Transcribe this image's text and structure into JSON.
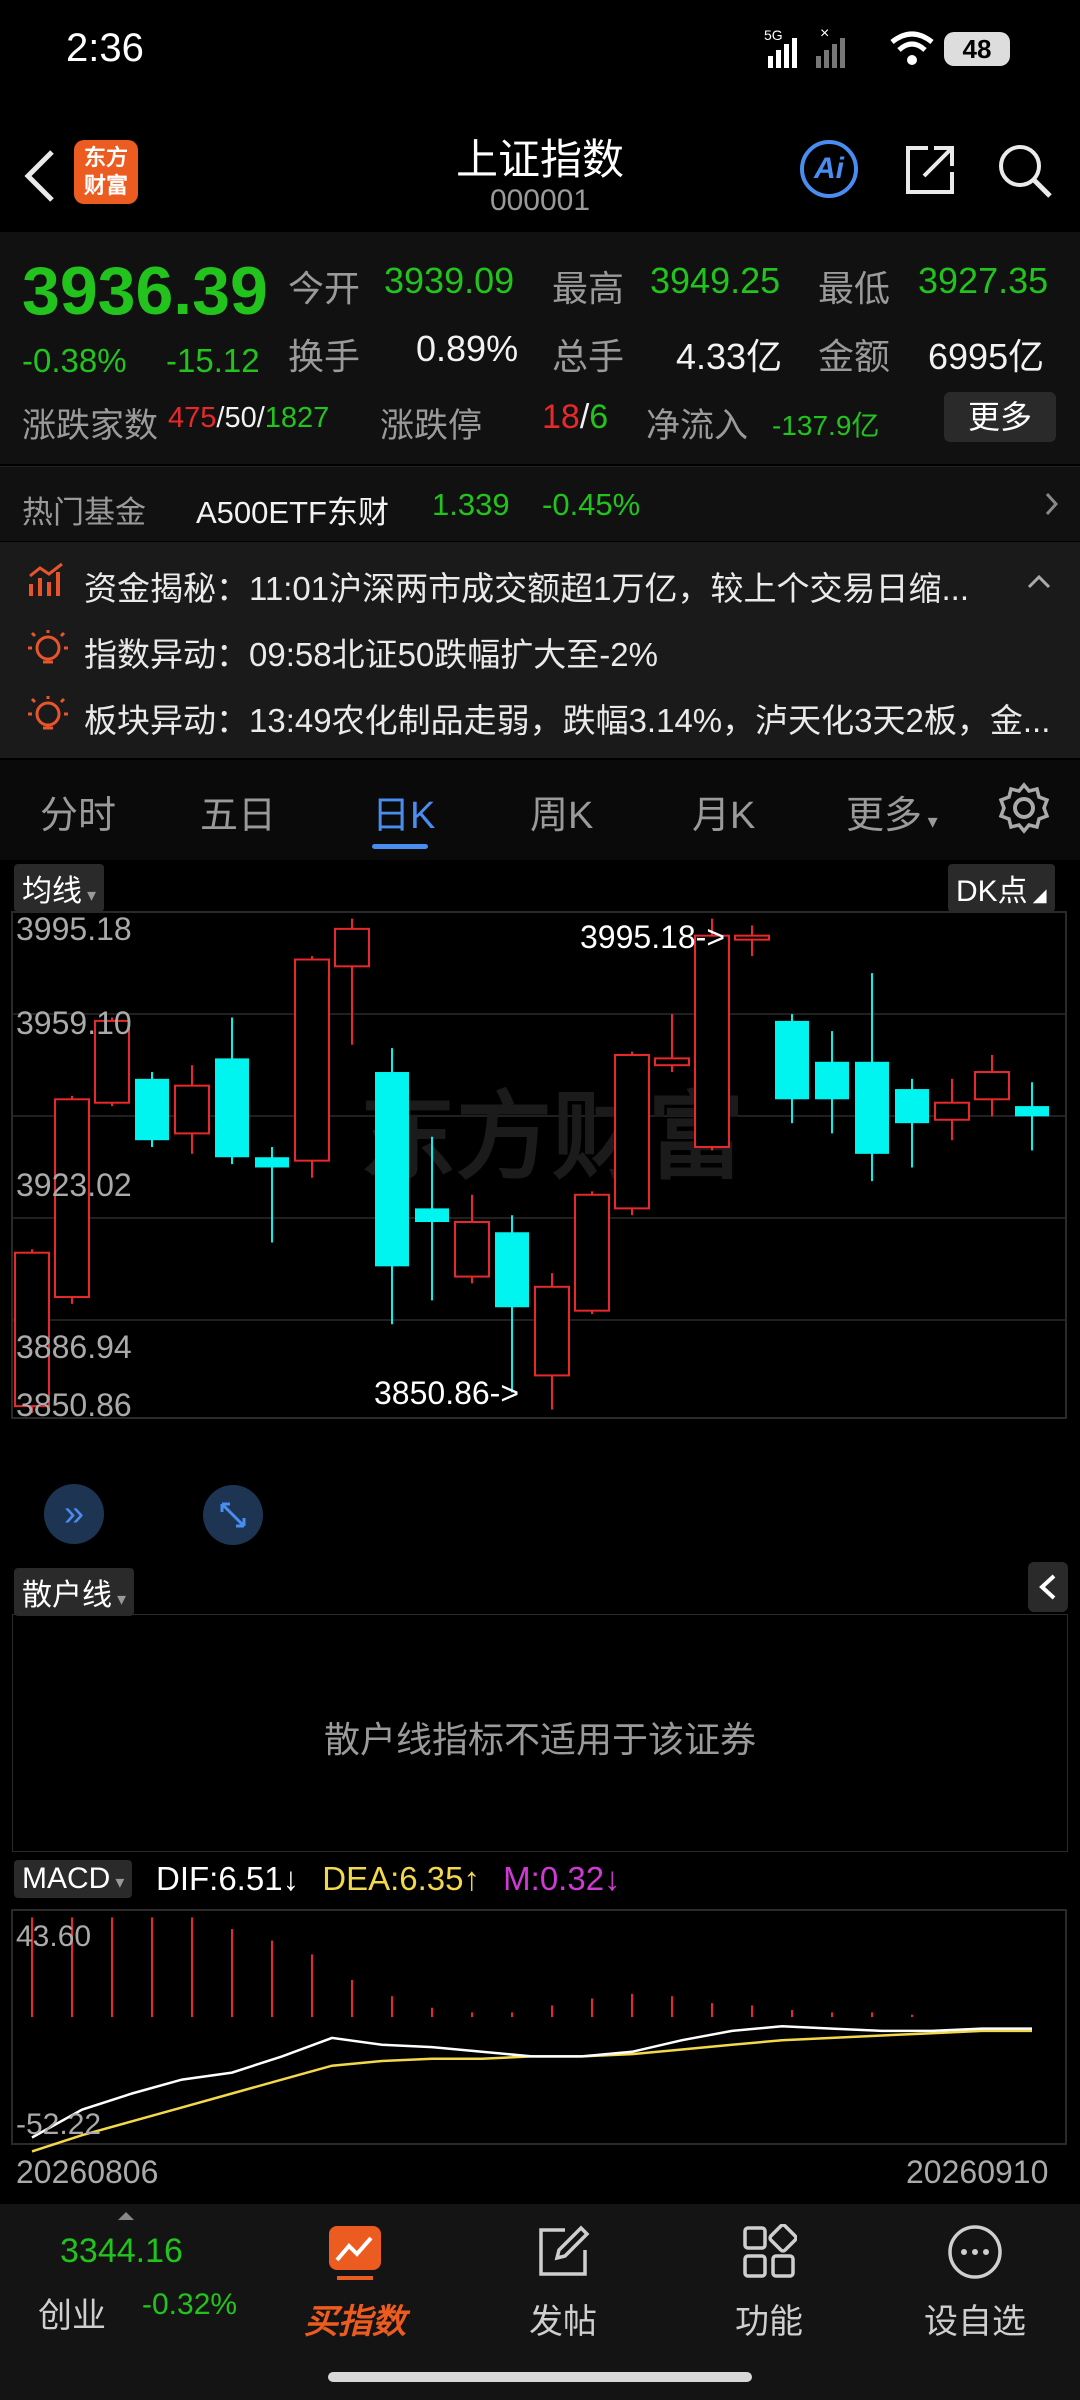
{
  "status_bar": {
    "time": "2:36",
    "net": "5G",
    "battery": "48"
  },
  "header": {
    "title": "上证指数",
    "code": "000001",
    "logo_line1": "东方",
    "logo_line2": "财富",
    "ai_label": "Ai"
  },
  "quote": {
    "price": "3936.39",
    "change_pct": "-0.38%",
    "change": "-15.12",
    "open_label": "今开",
    "open": "3939.09",
    "high_label": "最高",
    "high": "3949.25",
    "low_label": "最低",
    "low": "3927.35",
    "turnover_label": "换手",
    "turnover": "0.89%",
    "volume_label": "总手",
    "volume": "4.33亿",
    "amount_label": "金额",
    "amount": "6995亿",
    "breadth_label": "涨跌家数",
    "up": "475",
    "flat": "50",
    "down": "1827",
    "limit_label": "涨跌停",
    "limit_up": "18",
    "limit_down": "6",
    "netflow_label": "净流入",
    "netflow": "-137.9亿",
    "more_label": "更多"
  },
  "fund": {
    "label": "热门基金",
    "name": "A500ETF东财",
    "price": "1.339",
    "pct": "-0.45%"
  },
  "news": [
    {
      "icon": "chart-icon",
      "text": "资金揭秘：11:01沪深两市成交额超1万亿，较上个交易日缩..."
    },
    {
      "icon": "bulb-icon",
      "text": "指数异动：09:58北证50跌幅扩大至-2%"
    },
    {
      "icon": "bulb-icon",
      "text": "板块异动：13:49农化制品走弱，跌幅3.14%，泸天化3天2板，金..."
    }
  ],
  "tabs": [
    "分时",
    "五日",
    "日K",
    "周K",
    "月K",
    "更多"
  ],
  "active_tab": 2,
  "kline": {
    "ma_selector": "均线",
    "dk_selector": "DK点",
    "y_labels": [
      "3995.18",
      "3959.10",
      "3923.02",
      "3886.94",
      "3850.86"
    ],
    "max_marker": "3995.18->",
    "min_marker": "3850.86->",
    "watermark": "东方财富",
    "candles": [
      {
        "o": 3852,
        "c": 3897,
        "h": 3898,
        "l": 3850,
        "up": true
      },
      {
        "o": 3884,
        "c": 3942,
        "h": 3943,
        "l": 3882,
        "up": true
      },
      {
        "o": 3941,
        "c": 3965,
        "h": 3966,
        "l": 3940,
        "up": true
      },
      {
        "o": 3948,
        "c": 3930,
        "h": 3950,
        "l": 3928,
        "up": false
      },
      {
        "o": 3932,
        "c": 3946,
        "h": 3952,
        "l": 3926,
        "up": true
      },
      {
        "o": 3954,
        "c": 3925,
        "h": 3966,
        "l": 3923,
        "up": false
      },
      {
        "o": 3925,
        "c": 3922,
        "h": 3928,
        "l": 3900,
        "up": false
      },
      {
        "o": 3924,
        "c": 3983,
        "h": 3984,
        "l": 3919,
        "up": true
      },
      {
        "o": 3981,
        "c": 3992,
        "h": 3995,
        "l": 3958,
        "up": true
      },
      {
        "o": 3950,
        "c": 3893,
        "h": 3957,
        "l": 3876,
        "up": false
      },
      {
        "o": 3910,
        "c": 3906,
        "h": 3931,
        "l": 3883,
        "up": false
      },
      {
        "o": 3890,
        "c": 3906,
        "h": 3914,
        "l": 3888,
        "up": true
      },
      {
        "o": 3903,
        "c": 3881,
        "h": 3908,
        "l": 3856,
        "up": false
      },
      {
        "o": 3861,
        "c": 3887,
        "h": 3891,
        "l": 3851,
        "up": true
      },
      {
        "o": 3880,
        "c": 3914,
        "h": 3915,
        "l": 3879,
        "up": true
      },
      {
        "o": 3910,
        "c": 3955,
        "h": 3956,
        "l": 3908,
        "up": true
      },
      {
        "o": 3952,
        "c": 3954,
        "h": 3967,
        "l": 3950,
        "up": true
      },
      {
        "o": 3928,
        "c": 3990,
        "h": 3995,
        "l": 3927,
        "up": true
      },
      {
        "o": 3990,
        "c": 3990,
        "h": 3993,
        "l": 3984,
        "up": true
      },
      {
        "o": 3965,
        "c": 3942,
        "h": 3967,
        "l": 3935,
        "up": false
      },
      {
        "o": 3953,
        "c": 3942,
        "h": 3962,
        "l": 3932,
        "up": false
      },
      {
        "o": 3953,
        "c": 3926,
        "h": 3979,
        "l": 3918,
        "up": false
      },
      {
        "o": 3945,
        "c": 3935,
        "h": 3948,
        "l": 3922,
        "up": false
      },
      {
        "o": 3936,
        "c": 3941,
        "h": 3948,
        "l": 3930,
        "up": true
      },
      {
        "o": 3942,
        "c": 3950,
        "h": 3955,
        "l": 3937,
        "up": true
      },
      {
        "o": 3940,
        "c": 3937,
        "h": 3947,
        "l": 3927,
        "up": false
      }
    ]
  },
  "retail": {
    "selector": "散户线",
    "message": "散户线指标不适用于该证券"
  },
  "macd": {
    "selector": "MACD",
    "dif": "DIF:6.51",
    "dea": "DEA:6.35",
    "m": "M:0.32",
    "dif_arrow": "↓",
    "dea_arrow": "↑",
    "m_arrow": "↓",
    "y_top": "43.60",
    "y_bottom": "-52.22",
    "date_start": "20260806",
    "date_end": "20260910",
    "dif_series": [
      -52,
      -40,
      -33,
      -27,
      -24,
      -17,
      -9,
      -12,
      -13,
      -15,
      -17,
      -17,
      -15,
      -10,
      -6,
      -4,
      -5,
      -6,
      -6,
      -5,
      -5
    ],
    "dea_series": [
      -58,
      -51,
      -45,
      -39,
      -33,
      -27,
      -21,
      -19,
      -18,
      -18,
      -17,
      -17,
      -16,
      -14,
      -12,
      -10,
      -9,
      -8,
      -7,
      -6,
      -6
    ],
    "m_series": [
      43,
      43,
      43,
      43,
      43,
      38,
      33,
      27,
      16,
      9,
      4,
      2,
      2,
      5,
      8,
      10,
      9,
      6,
      5,
      3,
      2,
      2,
      1
    ]
  },
  "market_index": {
    "value": "3344.16",
    "name": "创业",
    "pct": "-0.32%"
  },
  "nav": [
    {
      "label": "买指数",
      "icon": "trend-icon",
      "active": true
    },
    {
      "label": "发帖",
      "icon": "edit-icon"
    },
    {
      "label": "功能",
      "icon": "apps-icon"
    },
    {
      "label": "设自选",
      "icon": "more-icon"
    }
  ],
  "colors": {
    "up": "#e8282b",
    "down": "#00f5f0",
    "dif": "#ffffff",
    "dea": "#f2d84a",
    "m": "#d03ad4",
    "accent": "#4a8df0"
  }
}
